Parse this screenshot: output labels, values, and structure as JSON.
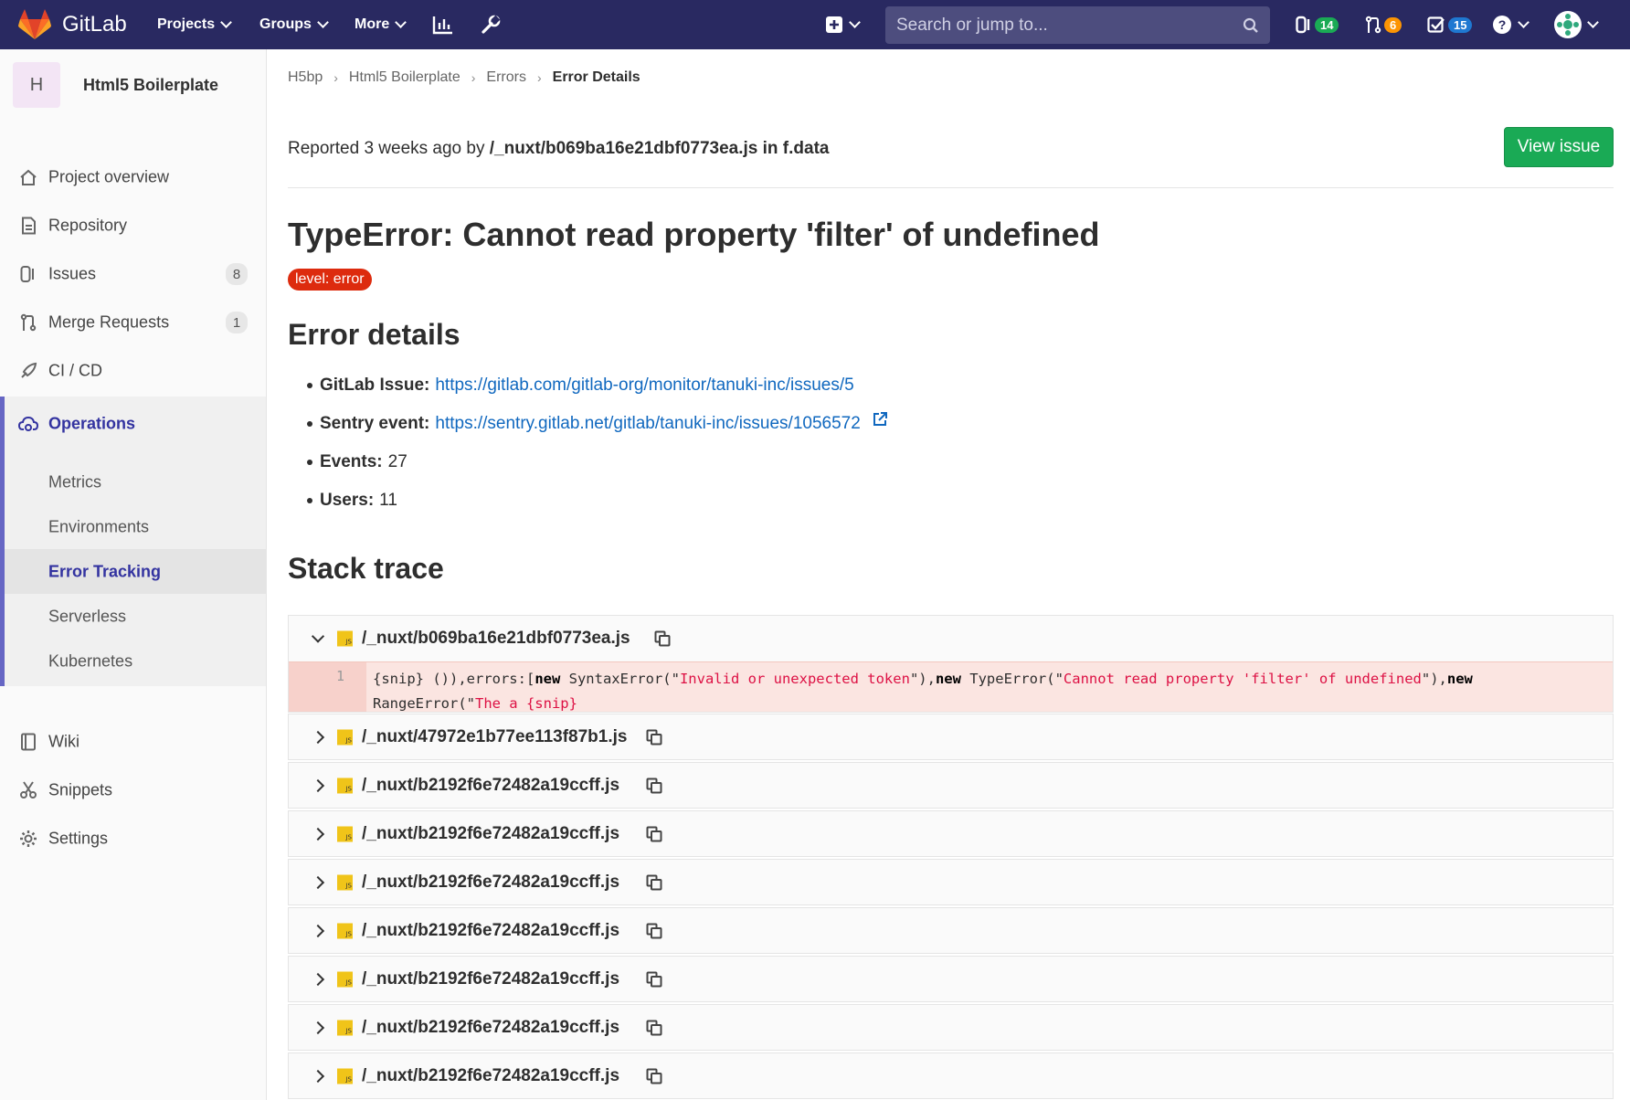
{
  "navbar": {
    "brand": "GitLab",
    "projects": "Projects",
    "groups": "Groups",
    "more": "More",
    "search_placeholder": "Search or jump to...",
    "issues_count": "14",
    "mr_count": "6",
    "todos_count": "15",
    "colors": {
      "bg": "#292961",
      "issues_badge": "#1aaa55",
      "mr_badge": "#fc9403",
      "todos_badge": "#1f78d1"
    }
  },
  "sidebar": {
    "project_initial": "H",
    "project_name": "Html5 Boilerplate",
    "items": [
      {
        "label": "Project overview",
        "icon": "home-icon"
      },
      {
        "label": "Repository",
        "icon": "doc-icon"
      },
      {
        "label": "Issues",
        "icon": "issues-icon",
        "count": "8"
      },
      {
        "label": "Merge Requests",
        "icon": "merge-request-icon",
        "count": "1"
      },
      {
        "label": "CI / CD",
        "icon": "rocket-icon"
      },
      {
        "label": "Operations",
        "icon": "cloud-gear-icon"
      },
      {
        "label": "Wiki",
        "icon": "book-icon"
      },
      {
        "label": "Snippets",
        "icon": "scissors-icon"
      },
      {
        "label": "Settings",
        "icon": "gear-icon"
      }
    ],
    "ops_sub": [
      "Metrics",
      "Environments",
      "Error Tracking",
      "Serverless",
      "Kubernetes"
    ],
    "active_sub": "Error Tracking"
  },
  "breadcrumb": [
    "H5bp",
    "Html5 Boilerplate",
    "Errors",
    "Error Details"
  ],
  "report": {
    "prefix": "Reported 3 weeks ago by",
    "culprit": "/_nuxt/b069ba16e21dbf0773ea.js in f.data"
  },
  "view_issue_label": "View issue",
  "error_title": "TypeError: Cannot read property 'filter' of undefined",
  "level_badge": "level: error",
  "details_heading": "Error details",
  "details": {
    "gitlab_issue_label": "GitLab Issue:",
    "gitlab_issue_url": "https://gitlab.com/gitlab-org/monitor/tanuki-inc/issues/5",
    "sentry_label": "Sentry event:",
    "sentry_url": "https://sentry.gitlab.net/gitlab/tanuki-inc/issues/1056572",
    "events_label": "Events:",
    "events_value": "27",
    "users_label": "Users:",
    "users_value": "11"
  },
  "stack_heading": "Stack trace",
  "frames": [
    {
      "file": "/_nuxt/b069ba16e21dbf0773ea.js",
      "expanded": true
    },
    {
      "file": "/_nuxt/47972e1b77ee113f87b1.js"
    },
    {
      "file": "/_nuxt/b2192f6e72482a19ccff.js"
    },
    {
      "file": "/_nuxt/b2192f6e72482a19ccff.js"
    },
    {
      "file": "/_nuxt/b2192f6e72482a19ccff.js"
    },
    {
      "file": "/_nuxt/b2192f6e72482a19ccff.js"
    },
    {
      "file": "/_nuxt/b2192f6e72482a19ccff.js"
    },
    {
      "file": "/_nuxt/b2192f6e72482a19ccff.js"
    },
    {
      "file": "/_nuxt/b2192f6e72482a19ccff.js"
    }
  ],
  "code": {
    "line_number": "1",
    "t1": "{snip} ()),errors:[",
    "k1": "new",
    "t2": " SyntaxError(\"",
    "s1": "Invalid or unexpected token",
    "t3": "\"),",
    "k2": "new",
    "t4": " TypeError(\"",
    "s2": "Cannot read property 'filter' of undefined",
    "t5": "\"),",
    "k3": "new",
    "t6": " RangeError(\"",
    "s3": "The a {snip}"
  }
}
